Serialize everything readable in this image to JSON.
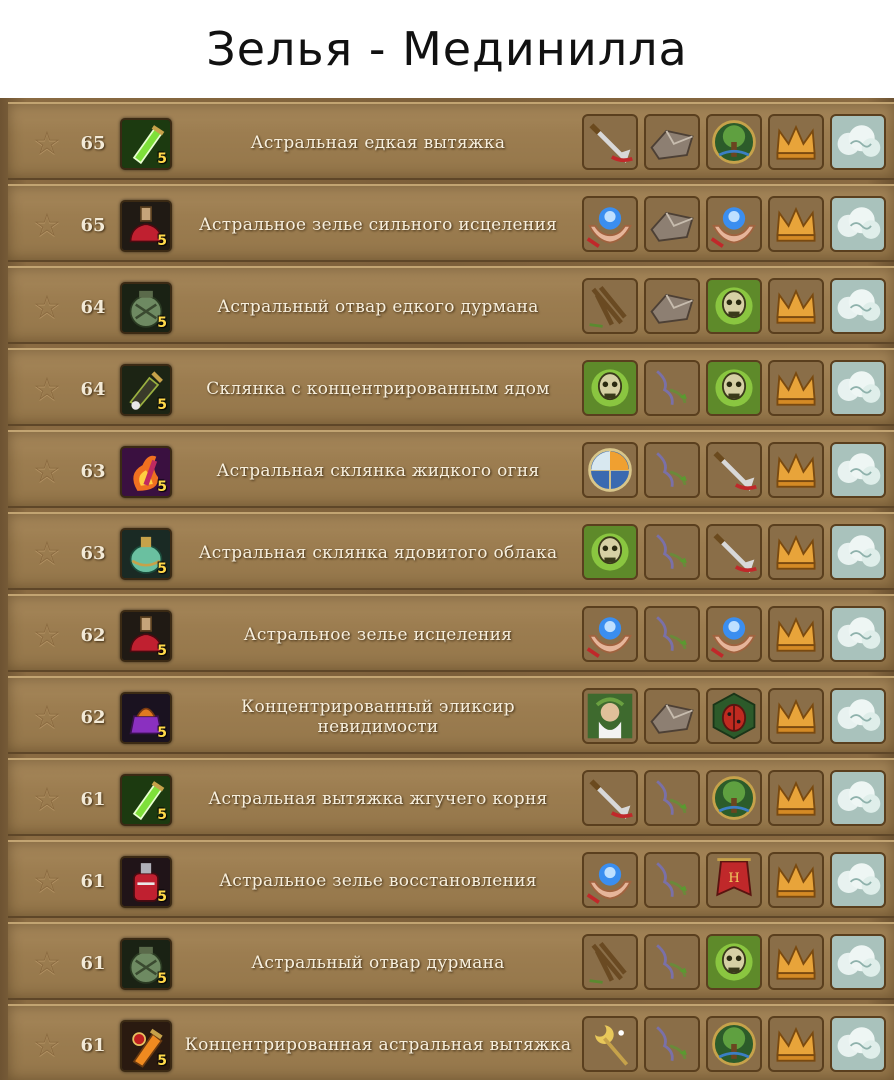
{
  "title": "Зелья - Мединилла",
  "rows": [
    {
      "level": "65",
      "name": "Астральная едкая вытяжка",
      "potion": "green-vial",
      "qty": "5",
      "ingredients": [
        "dagger-icon",
        "stone-icon",
        "tree-icon",
        "crown-icon",
        "cloud-icon"
      ]
    },
    {
      "level": "65",
      "name": "Астральное зелье сильного исцеления",
      "potion": "red-flask",
      "qty": "5",
      "ingredients": [
        "healing-hands-icon",
        "stone-icon",
        "healing-hands-icon",
        "crown-icon",
        "cloud-icon"
      ]
    },
    {
      "level": "64",
      "name": "Астральный отвар едкого дурмана",
      "potion": "green-jar",
      "qty": "5",
      "ingredients": [
        "root-icon",
        "stone-icon",
        "skull-icon",
        "crown-icon",
        "cloud-icon"
      ]
    },
    {
      "level": "64",
      "name": "Склянка с концентрированным ядом",
      "potion": "poison-bottle",
      "qty": "5",
      "ingredients": [
        "skull-icon",
        "herb-sprig-icon",
        "skull-icon",
        "crown-icon",
        "cloud-icon"
      ]
    },
    {
      "level": "63",
      "name": "Астральная склянка жидкого огня",
      "potion": "fire-vial",
      "qty": "5",
      "ingredients": [
        "elements-orb-icon",
        "herb-sprig-icon",
        "dagger-icon",
        "crown-icon",
        "cloud-icon"
      ]
    },
    {
      "level": "63",
      "name": "Астральная склянка ядовитого облака",
      "potion": "green-round-bottle",
      "qty": "5",
      "ingredients": [
        "skull-icon",
        "herb-sprig-icon",
        "dagger-icon",
        "crown-icon",
        "cloud-icon"
      ]
    },
    {
      "level": "62",
      "name": "Астральное зелье исцеления",
      "potion": "red-flask",
      "qty": "5",
      "ingredients": [
        "healing-hands-icon",
        "herb-sprig-icon",
        "healing-hands-icon",
        "crown-icon",
        "cloud-icon"
      ]
    },
    {
      "level": "62",
      "name": "Концентрированный эликсир невидимости",
      "potion": "purple-bottle",
      "qty": "5",
      "ingredients": [
        "druid-icon",
        "stone-icon",
        "beetle-icon",
        "crown-icon",
        "cloud-icon"
      ]
    },
    {
      "level": "61",
      "name": "Астральная вытяжка жгучего корня",
      "potion": "green-vial",
      "qty": "5",
      "ingredients": [
        "dagger-icon",
        "herb-sprig-icon",
        "tree-icon",
        "crown-icon",
        "cloud-icon"
      ]
    },
    {
      "level": "61",
      "name": "Астральное зелье восстановления",
      "potion": "red-bottle",
      "qty": "5",
      "ingredients": [
        "healing-hands-icon",
        "herb-sprig-icon",
        "banner-icon",
        "crown-icon",
        "cloud-icon"
      ]
    },
    {
      "level": "61",
      "name": "Астральный отвар дурмана",
      "potion": "green-jar",
      "qty": "5",
      "ingredients": [
        "root-icon",
        "herb-sprig-icon",
        "skull-icon",
        "crown-icon",
        "cloud-icon"
      ]
    },
    {
      "level": "61",
      "name": "Концентрированная астральная вытяжка",
      "potion": "orange-vial",
      "qty": "5",
      "ingredients": [
        "moon-staff-icon",
        "herb-sprig-icon",
        "tree-icon",
        "crown-icon",
        "cloud-icon"
      ]
    }
  ]
}
